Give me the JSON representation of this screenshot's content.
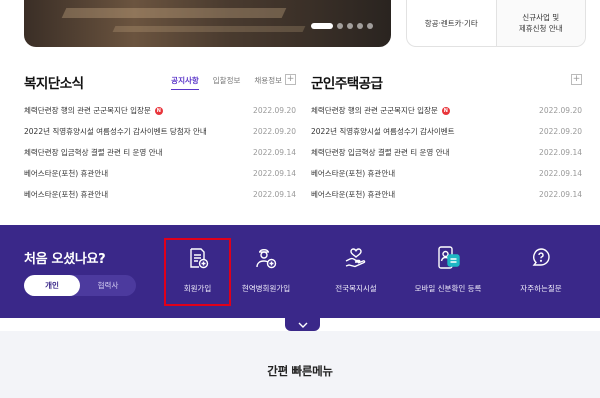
{
  "banner": {
    "indicator_count": 5,
    "active_index": 0
  },
  "quick_links": [
    {
      "label": "항공·렌트카·기타"
    },
    {
      "label": "신규사업 및\n제휴신청 안내"
    }
  ],
  "welfare": {
    "title": "복지단소식",
    "tabs": [
      "공지사항",
      "입찰정보",
      "채용정보"
    ],
    "active_tab": 0,
    "more_label": "+",
    "items": [
      {
        "title": "체력단련장 행의 관련 군군복지단 입장문",
        "date": "2022.09.20",
        "new": true
      },
      {
        "title": "2022년 직영휴양시설 여름성수기 감사이벤트 당첨자 안내",
        "date": "2022.09.20",
        "new": false
      },
      {
        "title": "체력단련장 입금혁상 결렬 관련 티 운영 안내",
        "date": "2022.09.14",
        "new": false
      },
      {
        "title": "베어스타운(포천) 휴관안내",
        "date": "2022.09.14",
        "new": false
      },
      {
        "title": "베어스타운(포천) 휴관안내",
        "date": "2022.09.14",
        "new": false
      }
    ]
  },
  "housing": {
    "title": "군인주택공급",
    "more_label": "+",
    "items": [
      {
        "title": "체력단련장 행의 관련 군군복지단 입장문",
        "date": "2022.09.20",
        "new": true
      },
      {
        "title": "2022년 직영휴양시설 여름성수기 감사이벤트",
        "date": "2022.09.20",
        "new": false
      },
      {
        "title": "체력단련장 입금혁상 결렬 관련 티 운영 안내",
        "date": "2022.09.14",
        "new": false
      },
      {
        "title": "베어스타운(포천) 휴관안내",
        "date": "2022.09.14",
        "new": false
      },
      {
        "title": "베어스타운(포천) 휴관안내",
        "date": "2022.09.14",
        "new": false
      }
    ]
  },
  "new_badge": "N",
  "first_visit": {
    "title": "처음 오셨나요?",
    "toggle": [
      "개인",
      "협력사"
    ],
    "active_toggle": 0,
    "menu": [
      {
        "label": "회원가입",
        "icon": "document-plus-icon"
      },
      {
        "label": "현역병회원가입",
        "icon": "user-plus-icon"
      },
      {
        "label": "전국복지시설",
        "icon": "hand-heart-icon"
      },
      {
        "label": "모바일 신분확인 등록",
        "icon": "mobile-id-icon"
      },
      {
        "label": "자주하는질문",
        "icon": "question-chat-icon"
      }
    ]
  },
  "quick_menu": {
    "title": "간편 빠른메뉴"
  },
  "colors": {
    "primary": "#3a2889",
    "accent": "#5a35c9",
    "badge": "#e8353b",
    "highlight": "#e0001a"
  }
}
